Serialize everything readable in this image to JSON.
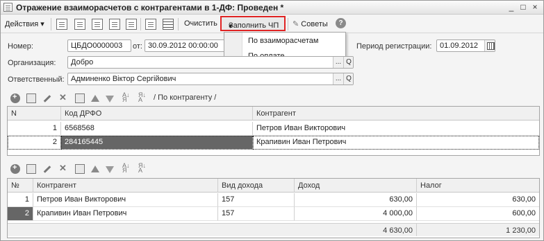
{
  "window": {
    "title": "Отражение взаиморасчетов с контрагентами в 1-ДФ: Проведен *",
    "controls": [
      "_",
      "□",
      "×"
    ]
  },
  "toolbar": {
    "actions": "Действия",
    "clear": "Очистить",
    "fill": "Заполнить ЧП",
    "tips": "Советы",
    "help": "?"
  },
  "dropdown": {
    "items": [
      "По взаиморасчетам",
      "По оплате"
    ]
  },
  "form": {
    "number_label": "Номер:",
    "number_value": "ЦБДО0000003",
    "from_label": "от:",
    "date_value": "30.09.2012 00:00:00",
    "period_label": "Период регистрации:",
    "period_value": "01.09.2012",
    "org_label": "Организация:",
    "org_value": "Добро",
    "resp_label": "Ответственный:",
    "resp_value": "Админенко Віктор Сергійович",
    "dots": "...",
    "search": "Q"
  },
  "grid1": {
    "filter": "/ По контрагенту /",
    "headers": [
      "N",
      "Код ДРФО",
      "Контрагент"
    ],
    "rows": [
      {
        "n": "1",
        "code": "6568568",
        "contractor": "Петров Иван Викторович"
      },
      {
        "n": "2",
        "code": "284165445",
        "contractor": "Крапивин Иван Петрович"
      }
    ]
  },
  "grid2": {
    "headers": [
      "№",
      "Контрагент",
      "Вид дохода",
      "Доход",
      "Налог"
    ],
    "rows": [
      {
        "n": "1",
        "contractor": "Петров Иван Викторович",
        "kind": "157",
        "income": "630,00",
        "tax": "630,00"
      },
      {
        "n": "2",
        "contractor": "Крапивин Иван Петрович",
        "kind": "157",
        "income": "4 000,00",
        "tax": "600,00"
      }
    ],
    "totals": {
      "income": "4 630,00",
      "tax": "1 230,00"
    }
  }
}
